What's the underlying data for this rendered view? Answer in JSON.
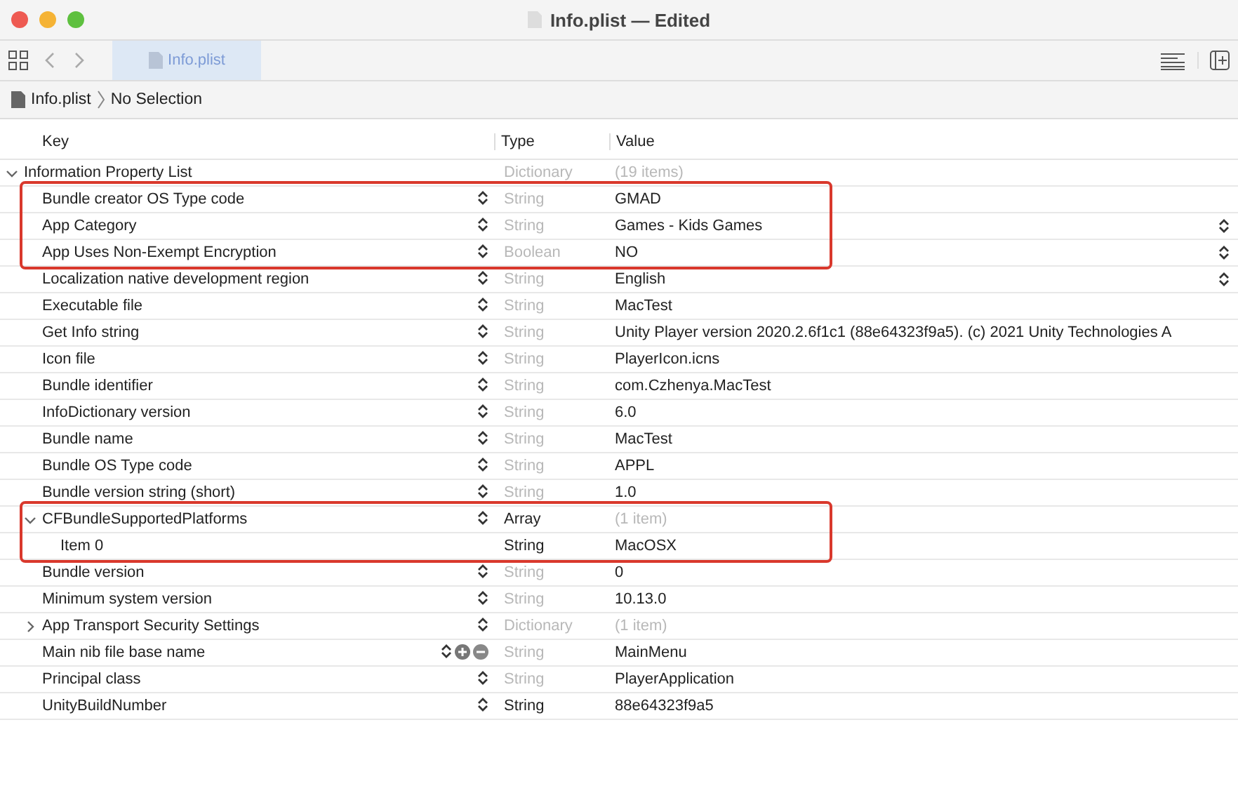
{
  "window": {
    "title": "Info.plist — Edited"
  },
  "tab": {
    "label": "Info.plist",
    "selected": true
  },
  "jump_bar": {
    "file": "Info.plist",
    "selection": "No Selection"
  },
  "columns": [
    "Key",
    "Type",
    "Value"
  ],
  "root": {
    "key": "Information Property List",
    "type": "Dictionary",
    "value": "(19 items)",
    "type_dimmed": true,
    "value_dimmed": true,
    "expanded": true,
    "children": [
      {
        "key": "Bundle creator OS Type code",
        "type": "String",
        "value": "GMAD",
        "type_dimmed": true,
        "stepper": true,
        "highlighted": true
      },
      {
        "key": "App Category",
        "type": "String",
        "value": "Games - Kids Games",
        "type_dimmed": true,
        "stepper": true,
        "value_popup": true,
        "highlighted": true
      },
      {
        "key": "App Uses Non-Exempt Encryption",
        "type": "Boolean",
        "value": "NO",
        "type_dimmed": true,
        "stepper": true,
        "value_popup": true,
        "highlighted": true
      },
      {
        "key": "Localization native development region",
        "type": "String",
        "value": "English",
        "type_dimmed": true,
        "stepper": true,
        "value_popup": true
      },
      {
        "key": "Executable file",
        "type": "String",
        "value": "MacTest",
        "type_dimmed": true,
        "stepper": true
      },
      {
        "key": "Get Info string",
        "type": "String",
        "value": "Unity Player version 2020.2.6f1c1 (88e64323f9a5). (c) 2021 Unity Technologies A",
        "type_dimmed": true,
        "stepper": true
      },
      {
        "key": "Icon file",
        "type": "String",
        "value": "PlayerIcon.icns",
        "type_dimmed": true,
        "stepper": true
      },
      {
        "key": "Bundle identifier",
        "type": "String",
        "value": "com.Czhenya.MacTest",
        "type_dimmed": true,
        "stepper": true
      },
      {
        "key": "InfoDictionary version",
        "type": "String",
        "value": "6.0",
        "type_dimmed": true,
        "stepper": true
      },
      {
        "key": "Bundle name",
        "type": "String",
        "value": "MacTest",
        "type_dimmed": true,
        "stepper": true
      },
      {
        "key": "Bundle OS Type code",
        "type": "String",
        "value": "APPL",
        "type_dimmed": true,
        "stepper": true
      },
      {
        "key": "Bundle version string (short)",
        "type": "String",
        "value": "1.0",
        "type_dimmed": true,
        "stepper": true
      },
      {
        "key": "CFBundleSupportedPlatforms",
        "type": "Array",
        "value": "(1 item)",
        "type_dimmed": false,
        "value_dimmed": true,
        "stepper": true,
        "expanded": true,
        "highlighted": true,
        "children": [
          {
            "key": "Item 0",
            "type": "String",
            "value": "MacOSX",
            "type_dimmed": false,
            "highlighted": true
          }
        ]
      },
      {
        "key": "Bundle version",
        "type": "String",
        "value": "0",
        "type_dimmed": true,
        "stepper": true
      },
      {
        "key": "Minimum system version",
        "type": "String",
        "value": "10.13.0",
        "type_dimmed": true,
        "stepper": true
      },
      {
        "key": "App Transport Security Settings",
        "type": "Dictionary",
        "value": "(1 item)",
        "type_dimmed": true,
        "value_dimmed": true,
        "stepper": true,
        "expanded": false
      },
      {
        "key": "Main nib file base name",
        "type": "String",
        "value": "MainMenu",
        "type_dimmed": true,
        "stepper": true,
        "hovered": true
      },
      {
        "key": "Principal class",
        "type": "String",
        "value": "PlayerApplication",
        "type_dimmed": true,
        "stepper": true
      },
      {
        "key": "UnityBuildNumber",
        "type": "String",
        "value": "88e64323f9a5",
        "type_dimmed": false,
        "stepper": true
      }
    ]
  }
}
